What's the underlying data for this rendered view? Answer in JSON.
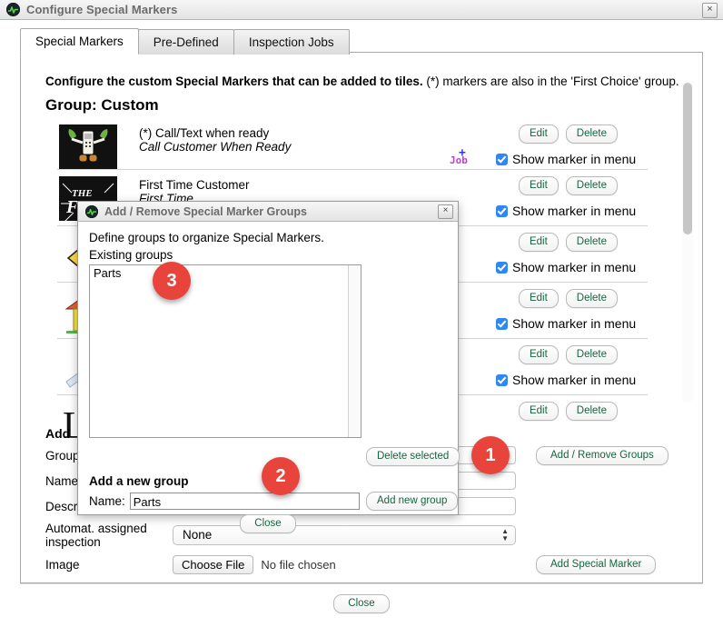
{
  "window": {
    "title": "Configure Special Markers",
    "close_label": "×",
    "icon": "app-waveform-icon"
  },
  "tabs": [
    {
      "label": "Special Markers",
      "active": true
    },
    {
      "label": "Pre-Defined",
      "active": false
    },
    {
      "label": "Inspection Jobs",
      "active": false
    }
  ],
  "main": {
    "intro_bold": "Configure the custom Special Markers that can be added to tiles.",
    "intro_rest": " (*) markers are also in the 'First Choice' group.",
    "group_heading": "Group: Custom",
    "add_section_title": "Add",
    "edit_label": "Edit",
    "delete_label": "Delete",
    "checkbox_label": "Show marker in menu",
    "job_icon_label": "Job"
  },
  "markers": [
    {
      "name": "(*) Call/Text when ready",
      "desc": "Call Customer When Ready",
      "thumb": "phone-character-thumb",
      "has_job_icon": true
    },
    {
      "name": "First Time Customer",
      "desc": "First Time",
      "thumb": "the-first-thumb",
      "has_job_icon": false
    },
    {
      "name": "",
      "desc": "",
      "thumb": "yellow-arrow-thumb",
      "has_job_icon": false
    },
    {
      "name": "",
      "desc": "",
      "thumb": "house-thumb",
      "has_job_icon": false
    },
    {
      "name": "",
      "desc": "",
      "thumb": "pencil-thumb",
      "has_job_icon": false
    },
    {
      "name": "",
      "desc": "",
      "thumb": "letter-l-thumb",
      "has_job_icon": false
    }
  ],
  "form": {
    "group_label": "Group",
    "name_label": "Name",
    "description_label": "Description",
    "inspection_label": "Automat. assigned inspection",
    "image_label": "Image",
    "group_value": "",
    "name_value": "",
    "description_value": "",
    "inspection_value": "None",
    "choose_file_label": "Choose File",
    "no_file_label": "No file chosen",
    "add_remove_groups_label": "Add / Remove Groups",
    "add_special_marker_label": "Add Special Marker"
  },
  "footer": {
    "close_label": "Close"
  },
  "modal": {
    "title": "Add / Remove Special Marker Groups",
    "close_label": "×",
    "description": "Define groups to organize Special Markers.",
    "existing_groups_label": "Existing groups",
    "groups": [
      "Parts"
    ],
    "delete_selected_label": "Delete selected",
    "add_new_group_title": "Add a new group",
    "name_label": "Name:",
    "name_value": "Parts",
    "add_new_group_button": "Add new group",
    "close_button": "Close"
  },
  "badges": [
    {
      "id": "1",
      "label": "1"
    },
    {
      "id": "2",
      "label": "2"
    },
    {
      "id": "3",
      "label": "3"
    }
  ],
  "colors": {
    "badge": "#e8443b",
    "checkbox": "#2f87f7",
    "button_text": "#15653f",
    "job_icon": "#c23ad8"
  }
}
